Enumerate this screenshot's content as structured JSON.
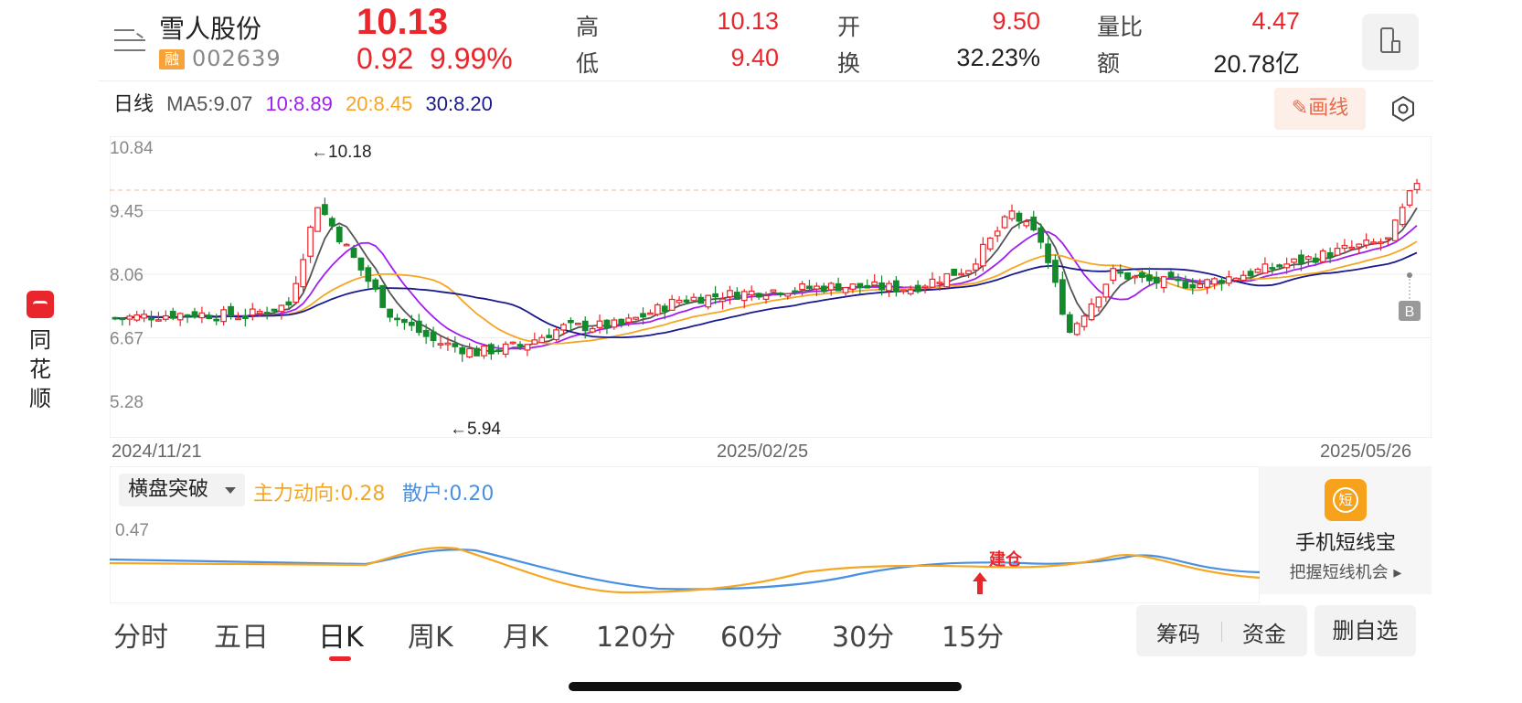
{
  "brand": {
    "chars": [
      "同",
      "花",
      "顺"
    ]
  },
  "stock": {
    "name": "雪人股份",
    "badge": "融",
    "code": "002639",
    "price": "10.13",
    "change": "0.92",
    "change_pct": "9.99%"
  },
  "quote": {
    "high_label": "高",
    "high": "10.13",
    "low_label": "低",
    "low": "9.40",
    "open_label": "开",
    "open": "9.50",
    "turnover_label": "换",
    "turnover": "32.23%",
    "vol_ratio_label": "量比",
    "vol_ratio": "4.47",
    "amount_label": "额",
    "amount": "20.78亿"
  },
  "ma": {
    "period_label": "日线",
    "ma5": "MA5:9.07",
    "ma10": "10:8.89",
    "ma20": "20:8.45",
    "ma30": "30:8.20"
  },
  "toolbar": {
    "draw_label": "画线"
  },
  "chart_data": {
    "type": "candlestick",
    "y_ticks": [
      "10.84",
      "9.45",
      "8.06",
      "6.67",
      "5.28"
    ],
    "ylim": [
      5.28,
      10.84
    ],
    "high_marker": "←10.18",
    "low_marker": "←5.94",
    "x_labels": [
      "2024/11/21",
      "2025/02/25",
      "2025/05/26"
    ],
    "signal_marker": "B",
    "colors": {
      "up": "#e8262b",
      "down": "#138a2c",
      "ma5": "#555555",
      "ma10": "#a020f0",
      "ma20": "#f5a623",
      "ma30": "#1a1a8c"
    }
  },
  "indicator": {
    "name": "横盘突破",
    "main_force": "主力动向:0.28",
    "retail": "散户:0.20",
    "level_tick": "0.47",
    "signal_label": "建仓"
  },
  "promo": {
    "title": "手机短线宝",
    "subtitle": "把握短线机会 ▸",
    "icon_text": "短"
  },
  "tabs": [
    "分时",
    "五日",
    "日K",
    "周K",
    "月K",
    "120分",
    "60分",
    "30分",
    "15分"
  ],
  "actions": {
    "chip": "筹码",
    "money": "资金",
    "delete_watch": "删自选"
  }
}
